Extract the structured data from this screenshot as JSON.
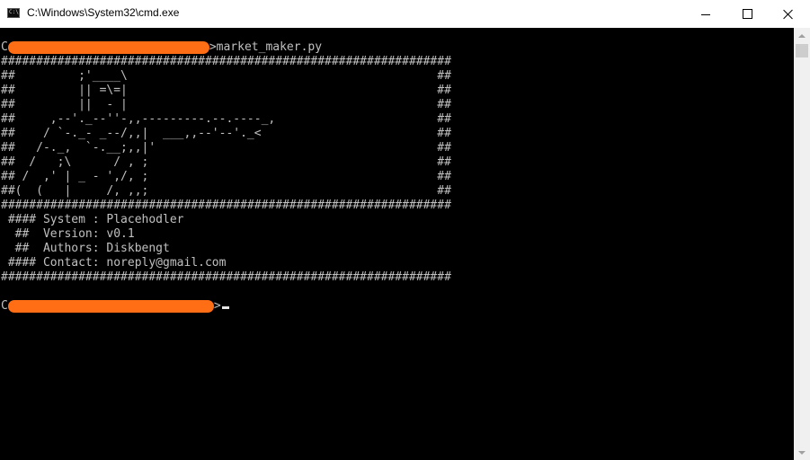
{
  "window": {
    "title": "C:\\Windows\\System32\\cmd.exe",
    "icon": "cmd-icon",
    "icon_glyph": "C:\\",
    "buttons": {
      "minimize": "minimize-icon",
      "maximize": "maximize-icon",
      "close": "close-icon"
    }
  },
  "console": {
    "background": "#000000",
    "text_color": "#c0c0c0",
    "redaction_color": "#ff6d14",
    "command_prefix": "C",
    "command": ">market_maker.py",
    "banner": [
      "################################################################",
      "##         ;'____\\                                            ##",
      "##         || =\\=|                                            ##",
      "##         ||  - |                                            ##",
      "##     ,--'._--''-,,---------.--.----_,                       ##",
      "##    / `-._- _--/,,|  ___,,--'--'._<                         ##",
      "##   /-._,  `-.__;,,|'                                        ##",
      "##  /   ;\\      / , ;                                         ##",
      "## /  ,' | _ - ',/, ;                                         ##",
      "##(  (   |     /, ,,;                                         ##",
      "################################################################",
      " #### System : Placehodler",
      "  ##  Version: v0.1",
      "  ##  Authors: Diskbengt",
      " #### Contact: noreply@gmail.com",
      "################################################################"
    ],
    "prompt_prefix": "C",
    "prompt_suffix": ">"
  }
}
